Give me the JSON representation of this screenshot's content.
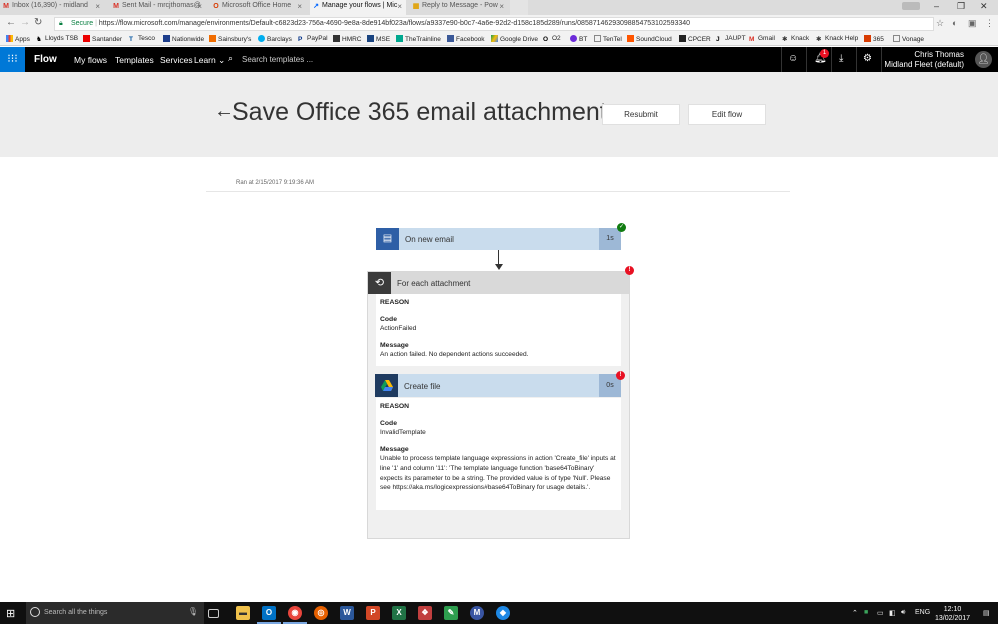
{
  "browser": {
    "tabs": [
      {
        "title": "Inbox (16,390) - midland",
        "favicon": "M",
        "favicon_color": "#d93025"
      },
      {
        "title": "Sent Mail - mrcjthomas@",
        "favicon": "M",
        "favicon_color": "#d93025"
      },
      {
        "title": "Microsoft Office Home",
        "favicon": "O",
        "favicon_color": "#d83b01"
      },
      {
        "title": "Manage your flows | Mic",
        "favicon": "↗",
        "favicon_color": "#0066ff"
      },
      {
        "title": "Reply to Message - Pow",
        "favicon": "▦",
        "favicon_color": "#e0a000"
      }
    ],
    "secure_label": "Secure",
    "url": "https://flow.microsoft.com/manage/environments/Default-c6823d23-756a-4690-9e8a-8de914bf023a/flows/a9337e90-b0c7-4a6e-92d2-d158c185d289/runs/08587146293098854753102593340",
    "bookmarks": [
      "Apps",
      "Lloyds TSB",
      "Santander",
      "Tesco",
      "Nationwide",
      "Sainsbury's",
      "Barclays",
      "PayPal",
      "HMRC",
      "MSE",
      "TheTrainline",
      "Facebook",
      "Google Drive",
      "O2",
      "BT",
      "TenTel",
      "SoundCloud",
      "CPCER",
      "JAUPT",
      "Gmail",
      "Knack",
      "Knack Help",
      "365",
      "Vonage"
    ]
  },
  "header": {
    "brand": "Flow",
    "nav": [
      "My flows",
      "Templates",
      "Services",
      "Learn"
    ],
    "search_placeholder": "Search templates ...",
    "notification_count": "1",
    "user_name": "Chris Thomas",
    "user_env": "Midland Fleet (default)"
  },
  "title_band": {
    "title": "Save Office 365 email attachments ...",
    "resubmit_label": "Resubmit",
    "edit_label": "Edit flow"
  },
  "run": {
    "ran_at": "Ran at 2/15/2017 9:19:36 AM"
  },
  "steps": {
    "trigger": {
      "title": "On new email",
      "duration": "1s"
    },
    "foreach": {
      "title": "For each attachment",
      "reason_label": "REASON",
      "code_label": "Code",
      "code": "ActionFailed",
      "message_label": "Message",
      "message": "An action failed. No dependent actions succeeded."
    },
    "create_file": {
      "title": "Create file",
      "duration": "0s",
      "reason_label": "REASON",
      "code_label": "Code",
      "code": "InvalidTemplate",
      "message_label": "Message",
      "message": "Unable to process template language expressions in action 'Create_file' inputs at line '1' and column '11': 'The template language function 'base64ToBinary' expects its parameter to be a string. The provided value is of type 'Null'. Please see https://aka.ms/logicexpressions#base64ToBinary for usage details.'."
    }
  },
  "taskbar": {
    "search_placeholder": "Search all the things",
    "language": "ENG",
    "time": "12:10",
    "date": "13/02/2017"
  }
}
